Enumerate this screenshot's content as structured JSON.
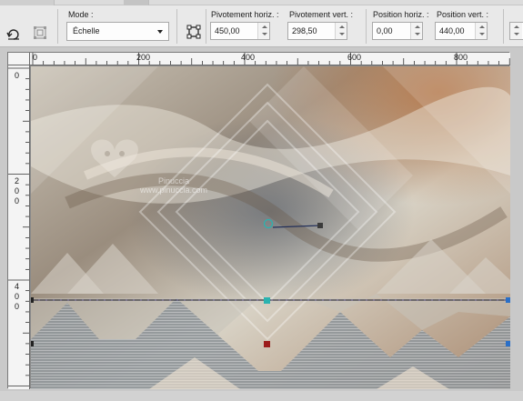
{
  "toolbar": {
    "mode_label": "Mode :",
    "mode_value": "Échelle",
    "pivot_h_label": "Pivotement horiz. :",
    "pivot_h_value": "450,00",
    "pivot_v_label": "Pivotement vert. :",
    "pivot_v_value": "298,50",
    "pos_h_label": "Position horiz. :",
    "pos_h_value": "0,00",
    "pos_v_label": "Position vert. :",
    "pos_v_value": "440,00",
    "icons": [
      "reset-icon",
      "scale-mode-icon",
      "pick-tool-icon"
    ]
  },
  "ruler_h_labels": [
    "0",
    "200",
    "400",
    "600",
    "800"
  ],
  "ruler_v_labels": [
    {
      "digits": [
        "0"
      ]
    },
    {
      "digits": [
        "2",
        "0",
        "0"
      ]
    },
    {
      "digits": [
        "4",
        "0",
        "0"
      ]
    }
  ],
  "watermark": {
    "name": "Pinuccia",
    "url": "www.pinuccia.com"
  },
  "colors": {
    "toolbar_bg": "#e9e9e9",
    "ruler_bg": "#f4f4f4",
    "handle_teal": "#2ab3b0",
    "handle_red": "#9c1c1c"
  }
}
